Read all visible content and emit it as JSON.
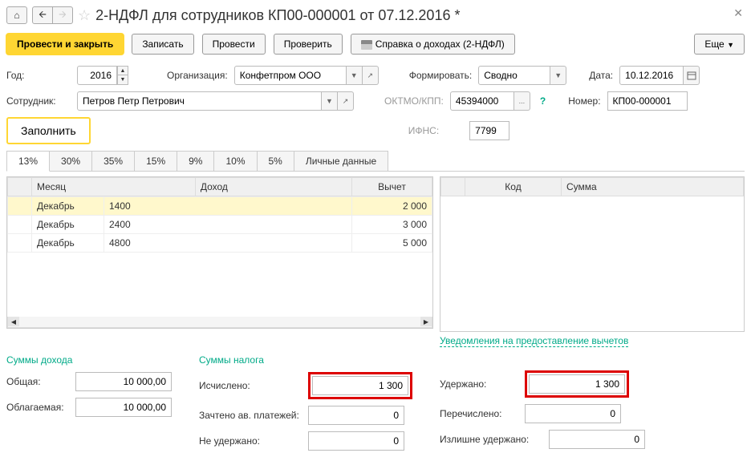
{
  "title": "2-НДФЛ для сотрудников КП00-000001 от 07.12.2016 *",
  "toolbar": {
    "post_close": "Провести и закрыть",
    "save": "Записать",
    "post": "Провести",
    "check": "Проверить",
    "print": "Справка о доходах (2-НДФЛ)",
    "more": "Еще"
  },
  "fields": {
    "year_label": "Год:",
    "year": "2016",
    "org_label": "Организация:",
    "org": "Конфетпром ООО",
    "form_label": "Формировать:",
    "form_mode": "Сводно",
    "date_label": "Дата:",
    "date": "10.12.2016",
    "emp_label": "Сотрудник:",
    "emp": "Петров Петр Петрович",
    "oktmo_label": "ОКТМО/КПП:",
    "oktmo": "45394000",
    "num_label": "Номер:",
    "num": "КП00-000001",
    "ifns_label": "ИФНС:",
    "ifns": "7799",
    "fill": "Заполнить"
  },
  "tabs": [
    "13%",
    "30%",
    "35%",
    "15%",
    "9%",
    "10%",
    "5%",
    "Личные данные"
  ],
  "grid_left": {
    "headers": [
      "Месяц",
      "Доход",
      "Вычет"
    ],
    "rows": [
      {
        "month": "Декабрь",
        "income": "1400",
        "deduct": "2 000",
        "sel": true
      },
      {
        "month": "Декабрь",
        "income": "2400",
        "deduct": "3 000"
      },
      {
        "month": "Декабрь",
        "income": "4800",
        "deduct": "5 000"
      }
    ]
  },
  "grid_right": {
    "headers": [
      "Код",
      "Сумма"
    ]
  },
  "link_deduct": "Уведомления на предоставление вычетов",
  "sums": {
    "income_head": "Суммы дохода",
    "total_label": "Общая:",
    "total": "10 000,00",
    "taxable_label": "Облагаемая:",
    "taxable": "10 000,00",
    "tax_head": "Суммы налога",
    "calc_label": "Исчислено:",
    "calc": "1 300",
    "adv_label": "Зачтено ав. платежей:",
    "adv": "0",
    "notheld_label": "Не удержано:",
    "notheld": "0",
    "held_label": "Удержано:",
    "held": "1 300",
    "transf_label": "Перечислено:",
    "transf": "0",
    "overheld_label": "Излишне удержано:",
    "overheld": "0"
  }
}
